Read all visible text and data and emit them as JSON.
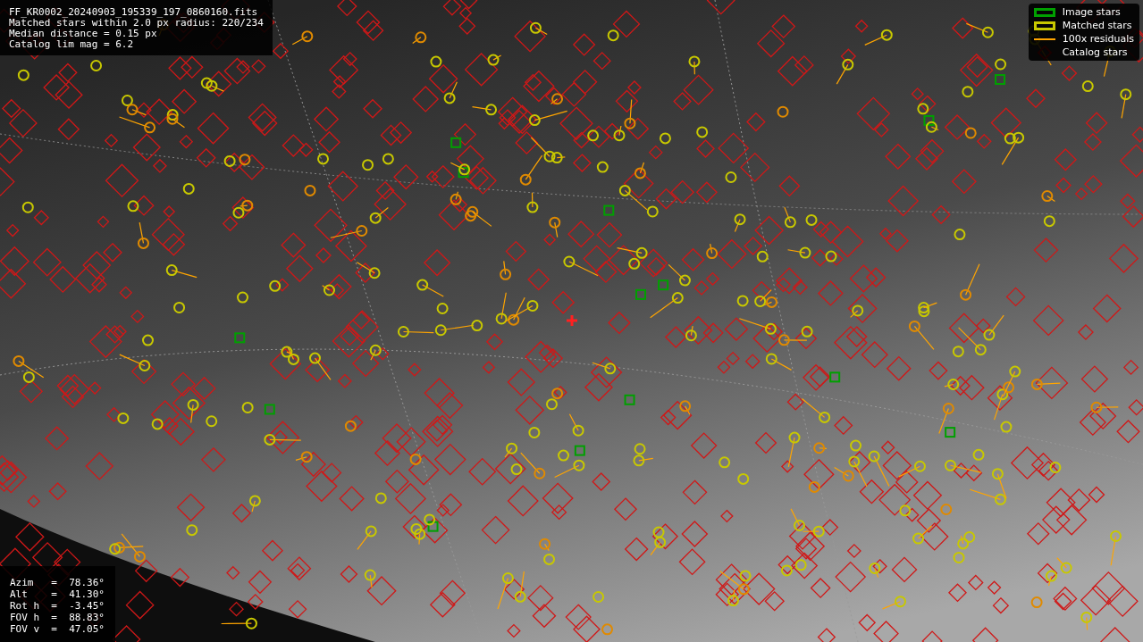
{
  "info_panel": {
    "lines": [
      "FF_KR0002_20240903_195339_197_0860160.fits",
      "Matched stars within 2.0 px radius: 220/234",
      "Median distance = 0.15 px",
      "Catalog lim mag = 6.2"
    ]
  },
  "legend": {
    "items": [
      {
        "kind": "box",
        "color": "#00a000",
        "label": "Image stars"
      },
      {
        "kind": "box",
        "color": "#c8c800",
        "label": "Matched stars"
      },
      {
        "kind": "line",
        "color": "#ffa500",
        "label": "100x residuals"
      },
      {
        "kind": "diamond",
        "color": "#1a0000",
        "label": "Catalog stars"
      }
    ]
  },
  "pointing_panel": {
    "lines": [
      "Azim   =  78.36°",
      "Alt    =  41.30°",
      "Rot h  =  -3.45°",
      "FOV h  =  88.83°",
      "FOV v  =  47.05°"
    ]
  }
}
